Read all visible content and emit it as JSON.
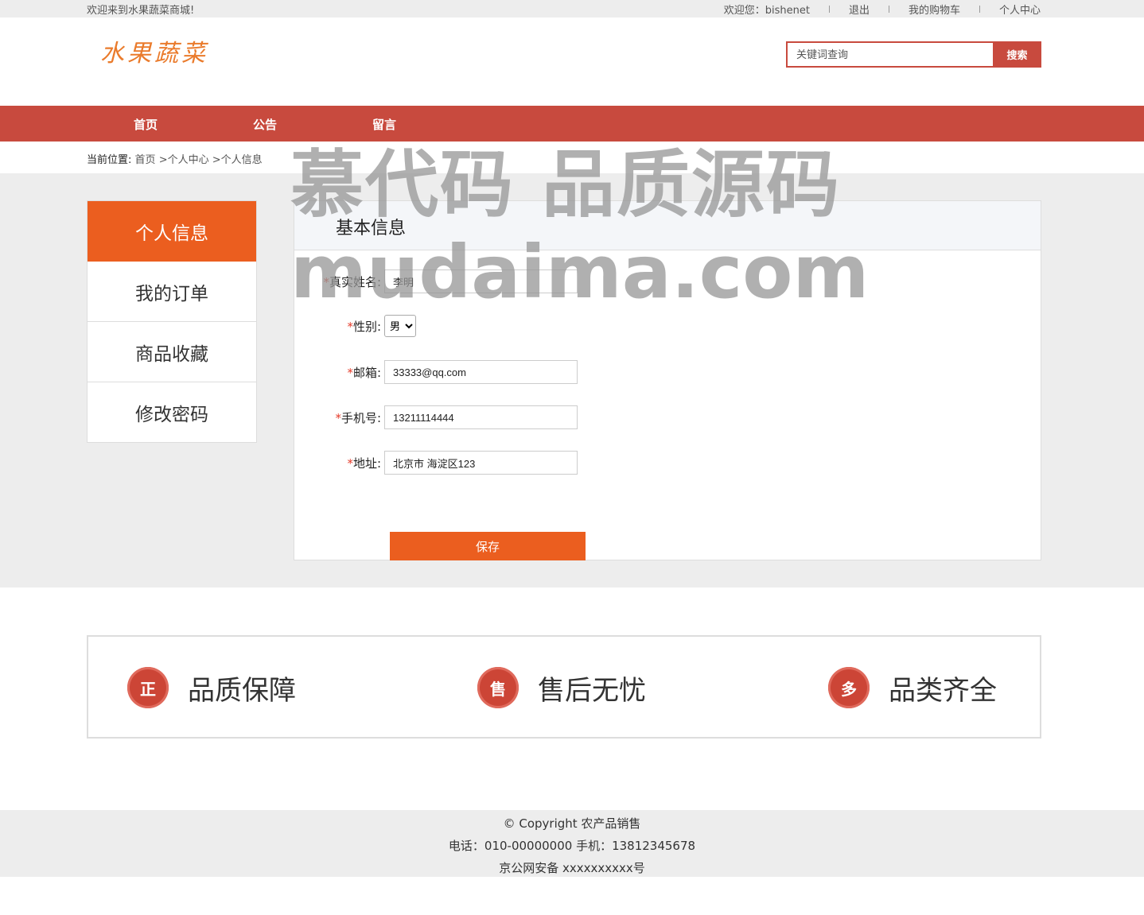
{
  "topbar": {
    "welcome": "欢迎来到水果蔬菜商城!",
    "user_greeting": "欢迎您：bishenet",
    "logout": "退出",
    "cart": "我的购物车",
    "profile": "个人中心"
  },
  "logo": {
    "text": "水果蔬菜"
  },
  "search": {
    "placeholder": "关键词查询",
    "button": "搜索"
  },
  "nav": {
    "items": [
      "首页",
      "公告",
      "留言"
    ]
  },
  "breadcrumb": {
    "prefix": "当前位置:",
    "home": "首页",
    "part1": " >个人中心",
    "part2": " >个人信息"
  },
  "sidebar": {
    "items": [
      "个人信息",
      "我的订单",
      "商品收藏",
      "修改密码"
    ],
    "active": "个人信息"
  },
  "panel": {
    "title": "基本信息",
    "fields": {
      "name": {
        "label": "真实姓名:",
        "value": "李明"
      },
      "gender": {
        "label": "性别:",
        "value": "男"
      },
      "email": {
        "label": "邮箱:",
        "value": "33333@qq.com"
      },
      "phone": {
        "label": "手机号:",
        "value": "13211114444"
      },
      "address": {
        "label": "地址:",
        "value": "北京市 海淀区123"
      }
    },
    "required_mark": "*",
    "save": "保存"
  },
  "features": [
    {
      "icon": "certified-icon",
      "glyph": "正",
      "text": "品质保障"
    },
    {
      "icon": "after-sales-icon",
      "glyph": "售",
      "text": "售后无忧"
    },
    {
      "icon": "variety-icon",
      "glyph": "多",
      "text": "品类齐全"
    }
  ],
  "footer": {
    "copyright": "© Copyright 农产品销售",
    "contact": "电话：010-00000000 手机：13812345678",
    "icp": "京公网安备 xxxxxxxxxx号"
  },
  "watermark": {
    "line1": "慕代码 品质源码",
    "line2": "mudaima.com"
  },
  "colors": {
    "brand_red": "#c84a3e",
    "accent_orange": "#eb5e1f",
    "logo_orange": "#ea7b2c"
  }
}
